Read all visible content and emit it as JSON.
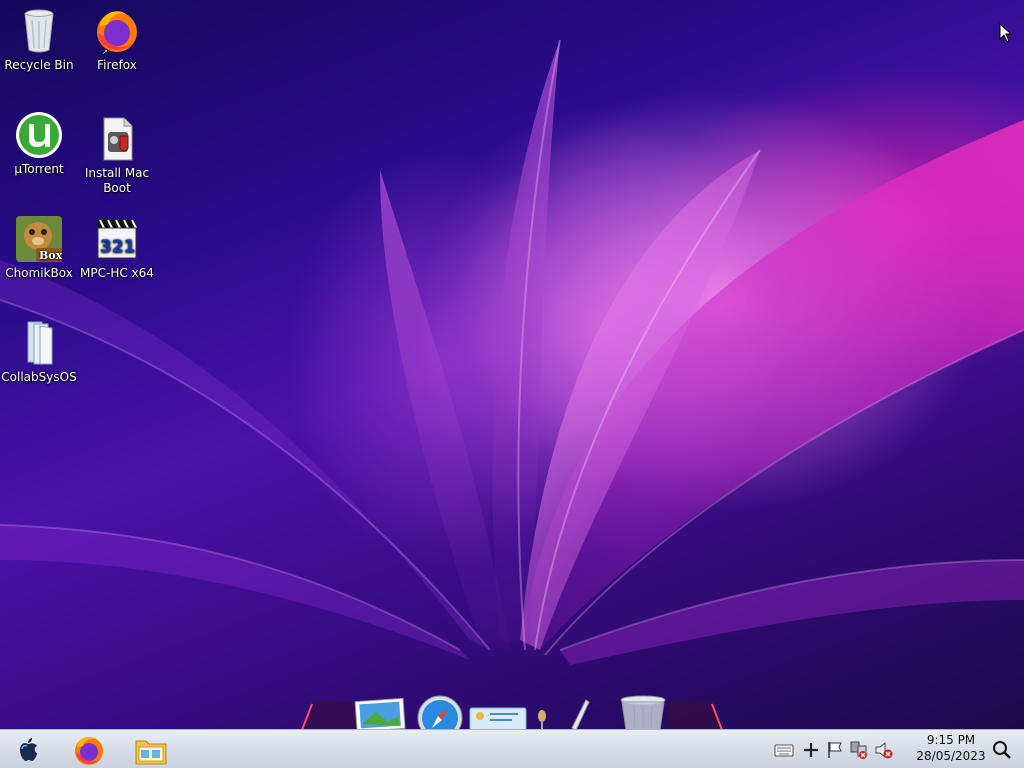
{
  "desktop": {
    "icons": [
      {
        "label": "Recycle Bin",
        "icon": "recycle-bin-icon"
      },
      {
        "label": "Firefox",
        "icon": "firefox-icon"
      },
      {
        "label": "µTorrent",
        "icon": "utorrent-icon"
      },
      {
        "label": "Install Mac Boot",
        "icon": "install-mac-boot-icon"
      },
      {
        "label": "ChomikBox",
        "icon": "chomikbox-icon"
      },
      {
        "label": "MPC-HC x64",
        "icon": "mpc-hc-icon"
      },
      {
        "label": "CollabSysOS",
        "icon": "folder-icon"
      }
    ],
    "chomikbox_badge": "Box",
    "mpc_badge": "321"
  },
  "dock": {
    "items": [
      "dock-photo-icon",
      "safari-icon",
      "dock-card-icon",
      "pen-icon",
      "trash-icon"
    ]
  },
  "taskbar": {
    "start_icon": "apple-icon",
    "pinned": [
      "firefox-icon",
      "file-explorer-icon"
    ],
    "tray": [
      "keyboard-icon",
      "plus-icon",
      "flag-icon",
      "network-error-icon",
      "volume-muted-icon"
    ],
    "clock": {
      "time": "9:15 PM",
      "date": "28/05/2023"
    },
    "search_icon": "search-icon"
  },
  "colors": {
    "wallpaper_dark": "#14085a",
    "wallpaper_pink": "#ec28aa",
    "taskbar": "#d6dde8"
  }
}
